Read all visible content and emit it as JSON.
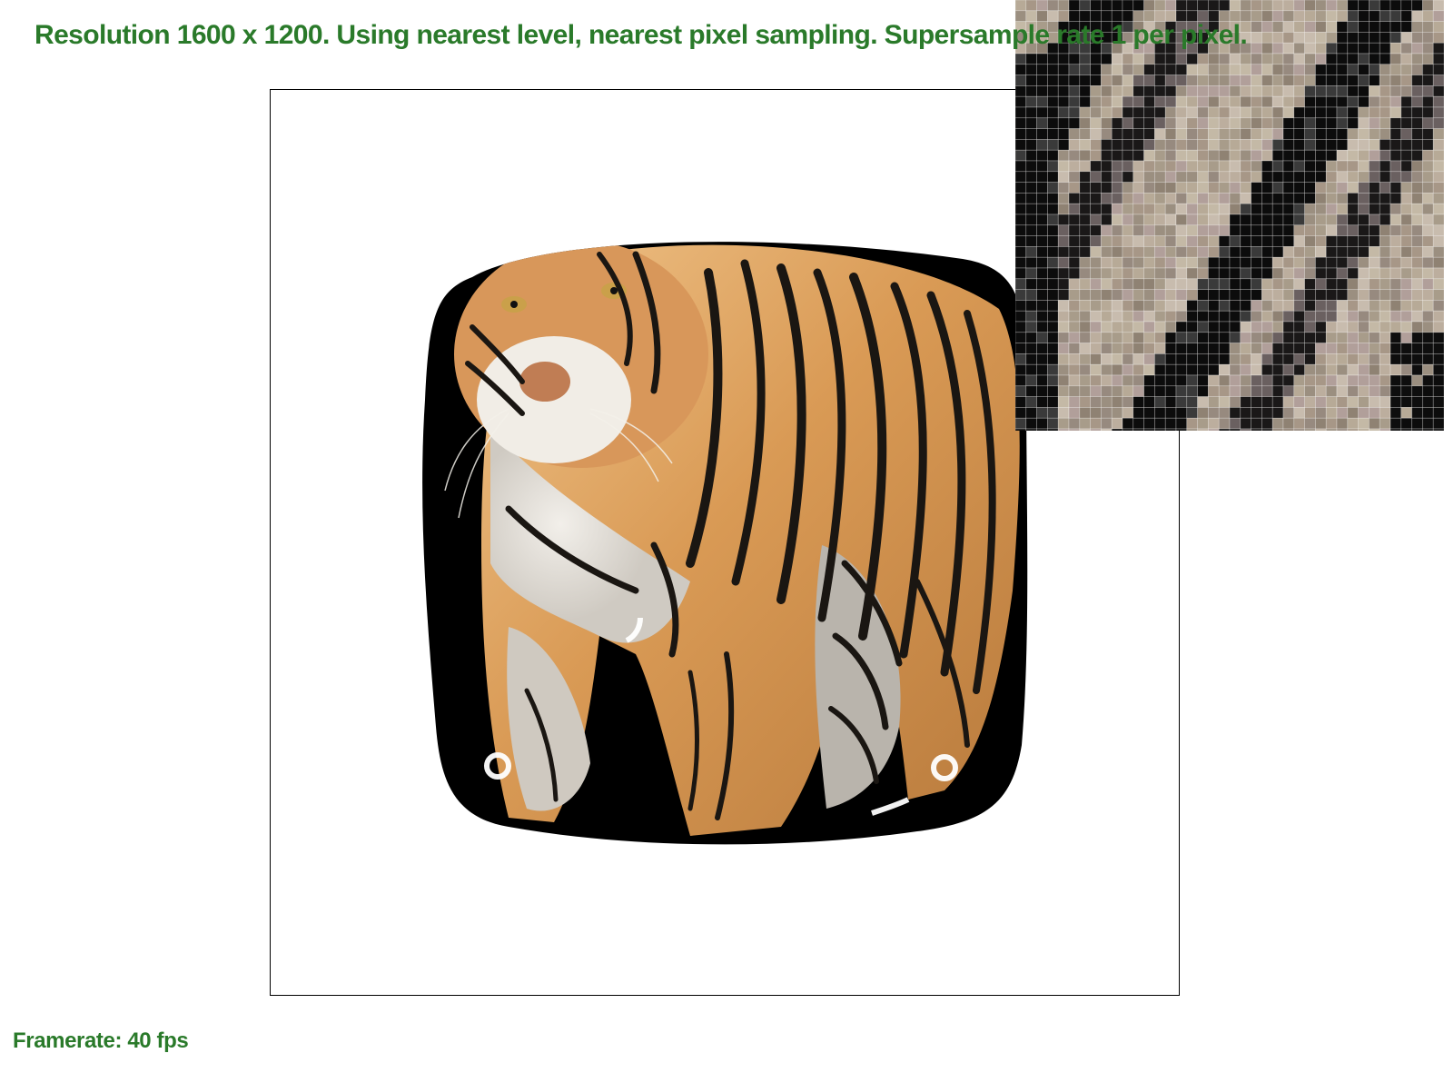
{
  "header": {
    "text": "Resolution 1600 x 1200. Using nearest level, nearest pixel sampling. Supersample rate 1 per pixel."
  },
  "footer": {
    "framerate_text": "Framerate: 40 fps"
  },
  "colors": {
    "overlay_text": "#2a7a2a",
    "background": "#ffffff",
    "frame_border": "#000000",
    "tiger_orange": "#d89a55",
    "tiger_light": "#e9c08a",
    "tiger_white": "#e6e3de",
    "tiger_stripe": "#1a1612",
    "backdrop_black": "#000000"
  },
  "zoom_panel": {
    "description_icon": "pixel-magnifier",
    "sampling": "nearest"
  }
}
